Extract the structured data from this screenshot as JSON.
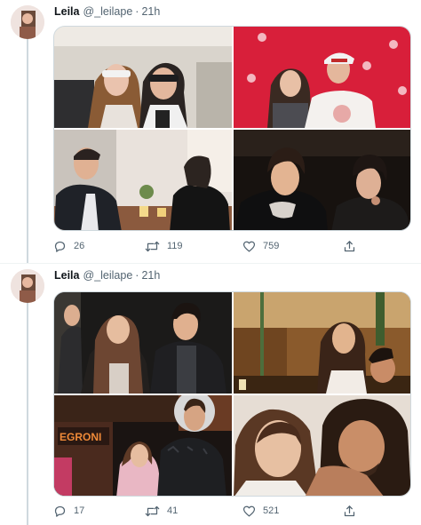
{
  "tweets": [
    {
      "display_name": "Leila",
      "handle": "@_leilape",
      "separator": "·",
      "time": "21h",
      "photos": [
        {
          "icon": "photo-1"
        },
        {
          "icon": "photo-2"
        },
        {
          "icon": "photo-3"
        },
        {
          "icon": "photo-4"
        }
      ],
      "reply_count": "26",
      "retweet_count": "119",
      "like_count": "759"
    },
    {
      "display_name": "Leila",
      "handle": "@_leilape",
      "separator": "·",
      "time": "21h",
      "photos": [
        {
          "icon": "photo-1"
        },
        {
          "icon": "photo-2"
        },
        {
          "icon": "photo-3",
          "sign_text": "EGRONI"
        },
        {
          "icon": "photo-4"
        }
      ],
      "reply_count": "17",
      "retweet_count": "41",
      "like_count": "521"
    }
  ],
  "icons": {
    "reply": "reply-icon",
    "retweet": "retweet-icon",
    "like": "heart-icon",
    "share": "share-icon"
  },
  "colors": {
    "text_primary": "#0f1419",
    "text_secondary": "#536471",
    "border": "#cfd9de",
    "poster_red": "#d81f3a"
  }
}
